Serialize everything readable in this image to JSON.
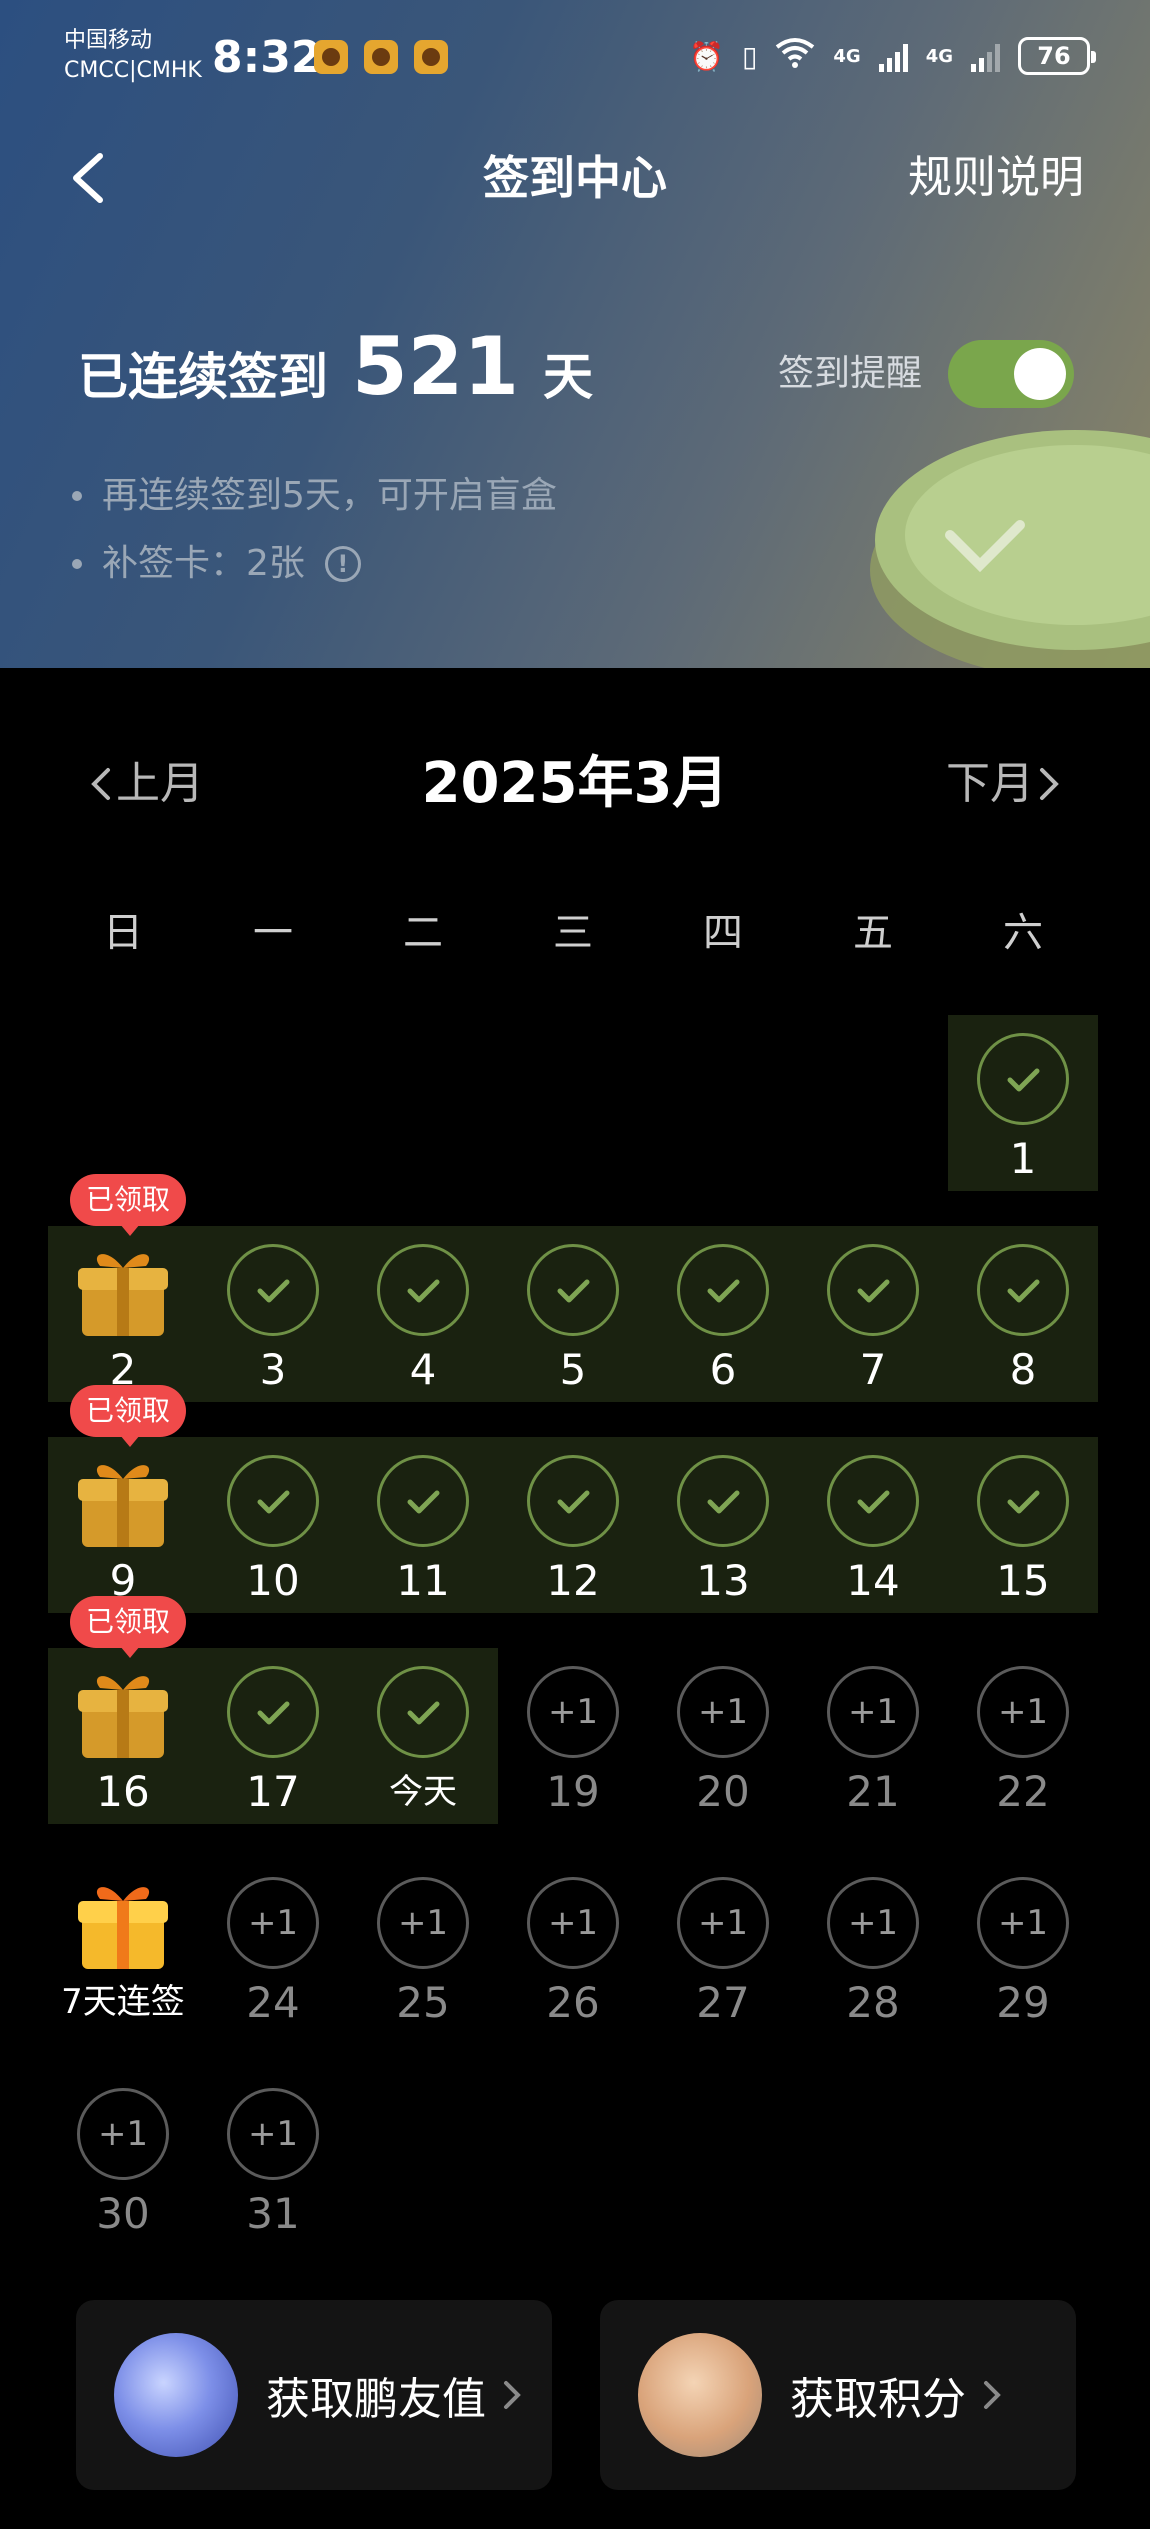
{
  "status_bar": {
    "carrier_line1": "中国移动",
    "carrier_line2": "CMCC|CMHK",
    "time": "8:32",
    "battery": "76",
    "network_1": "4G",
    "network_2": "4G"
  },
  "nav": {
    "title": "签到中心",
    "rules": "规则说明"
  },
  "streak": {
    "prefix": "已连续签到",
    "days": "521",
    "suffix": "天"
  },
  "reminder": {
    "label": "签到提醒",
    "enabled": true
  },
  "tips": {
    "line1": "再连续签到5天，可开启盲盒",
    "line2": "补签卡：2张"
  },
  "month_nav": {
    "prev": "上月",
    "title": "2025年3月",
    "next": "下月"
  },
  "weekdays": [
    "日",
    "一",
    "二",
    "三",
    "四",
    "五",
    "六"
  ],
  "calendar": {
    "claimed_badge": "已领取",
    "streak_gift_label": "7天连签",
    "today_label": "今天",
    "plus_label": "+1",
    "days": {
      "d1": "1",
      "d2": "2",
      "d3": "3",
      "d4": "4",
      "d5": "5",
      "d6": "6",
      "d7": "7",
      "d8": "8",
      "d9": "9",
      "d10": "10",
      "d11": "11",
      "d12": "12",
      "d13": "13",
      "d14": "14",
      "d15": "15",
      "d16": "16",
      "d17": "17",
      "d19": "19",
      "d20": "20",
      "d21": "21",
      "d22": "22",
      "d24": "24",
      "d25": "25",
      "d26": "26",
      "d27": "27",
      "d28": "28",
      "d29": "29",
      "d30": "30",
      "d31": "31"
    }
  },
  "cards": {
    "friend_value": "获取鹏友值",
    "points": "获取积分"
  },
  "colors": {
    "accent_green": "#7aa64c",
    "badge_red": "#f04a4a",
    "band_bg": "#1a2210"
  }
}
